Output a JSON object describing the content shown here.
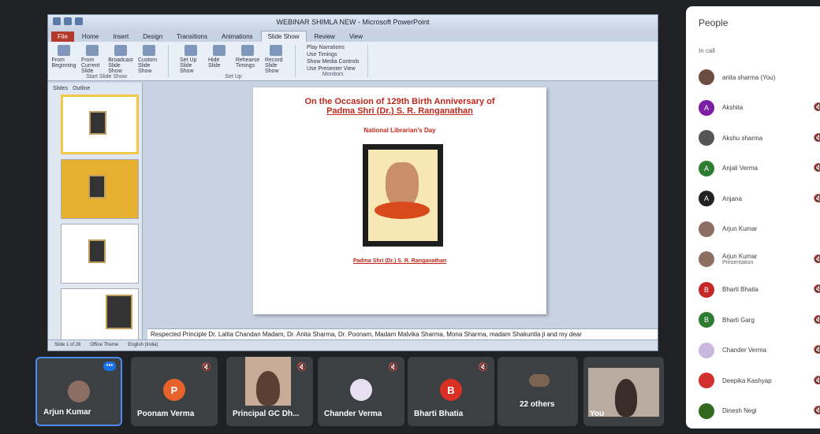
{
  "presentation": {
    "window_title": "WEBINAR SHIMLA NEW - Microsoft PowerPoint",
    "tabs": [
      "File",
      "Home",
      "Insert",
      "Design",
      "Transitions",
      "Animations",
      "Slide Show",
      "Review",
      "View"
    ],
    "active_tab": "Slide Show",
    "ribbon_groups": [
      {
        "label": "Start Slide Show",
        "buttons": [
          "From Beginning",
          "From Current Slide",
          "Broadcast Slide Show",
          "Custom Slide Show"
        ]
      },
      {
        "label": "Set Up",
        "buttons": [
          "Set Up Slide Show",
          "Hide Slide",
          "Rehearse Timings",
          "Record Slide Show"
        ]
      },
      {
        "label": "Monitors",
        "buttons": [
          "Play Narrations",
          "Use Timings",
          "Show Media Controls",
          "Use Presenter View"
        ]
      }
    ],
    "thumb_tabs": [
      "Slides",
      "Outline"
    ],
    "slide": {
      "line1": "On the Occasion of 129th Birth Anniversary of",
      "line2": "Padma Shri (Dr.) S. R. Ranganathan",
      "subtitle": "National Librarian's Day",
      "caption": "Padma Shri (Dr.) S. R. Ranganathan"
    },
    "notes": "Respected Principle Dr. Lalita Chandan Madam, Dr. Anita Sharma, Dr. Poonam, Madam Malvika Sharma, Mona Sharma, madam Shakuntla ji and my dear",
    "status": [
      "Slide 1 of 26",
      "Office Theme",
      "English (India)"
    ]
  },
  "people_panel": {
    "title": "People",
    "section": "In call",
    "participants": [
      {
        "name": "anita sharma (You)",
        "initial": "",
        "color": "#6d4c41",
        "sub": ""
      },
      {
        "name": "Akshita",
        "initial": "A",
        "color": "#7b1fa2",
        "sub": ""
      },
      {
        "name": "Akshu sharma",
        "initial": "",
        "color": "#555",
        "sub": ""
      },
      {
        "name": "Anjali Verma",
        "initial": "A",
        "color": "#2e7d32",
        "sub": ""
      },
      {
        "name": "Anjana",
        "initial": "A",
        "color": "#222",
        "sub": ""
      },
      {
        "name": "Arjun Kumar",
        "initial": "",
        "color": "#8d6e63",
        "sub": ""
      },
      {
        "name": "Arjun Kumar",
        "initial": "",
        "color": "#8d6e63",
        "sub": "Presentation"
      },
      {
        "name": "Bharti Bhatia",
        "initial": "B",
        "color": "#c62828",
        "sub": ""
      },
      {
        "name": "Bharti Garg",
        "initial": "B",
        "color": "#2e7d32",
        "sub": ""
      },
      {
        "name": "Chander Verma",
        "initial": "",
        "color": "#c9b7e0",
        "sub": ""
      },
      {
        "name": "Deepika Kashyap",
        "initial": "",
        "color": "#d32f2f",
        "sub": ""
      },
      {
        "name": "Dinesh Negi",
        "initial": "",
        "color": "#33691e",
        "sub": ""
      }
    ]
  },
  "tiles": [
    {
      "name": "Arjun Kumar",
      "initial": "",
      "color": "#8d6e63"
    },
    {
      "name": "Poonam Verma",
      "initial": "P",
      "color": "#e8632c"
    },
    {
      "name": "Principal GC Dh...",
      "initial": "",
      "color": ""
    },
    {
      "name": "Chander Verma",
      "initial": "",
      "color": "#e8dff3"
    },
    {
      "name": "Bharti Bhatia",
      "initial": "B",
      "color": "#d93025"
    },
    {
      "name": "22 others",
      "initial": "",
      "color": ""
    },
    {
      "name": "You",
      "initial": "",
      "color": ""
    }
  ],
  "icons": {
    "mic_off": "mic-off-icon",
    "more": "more-options-icon"
  }
}
